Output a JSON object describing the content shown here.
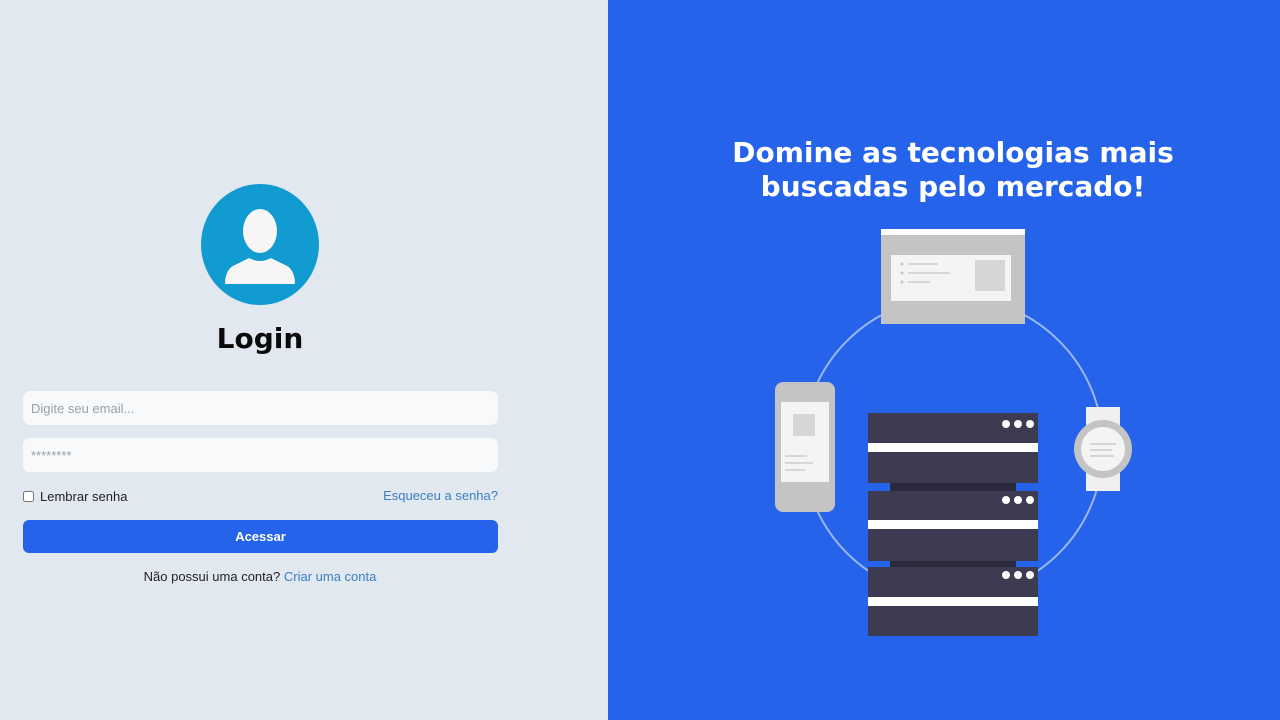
{
  "login": {
    "title": "Login",
    "email_placeholder": "Digite seu email...",
    "password_placeholder": "********",
    "remember_label": "Lembrar senha",
    "forgot_link": "Esqueceu a senha?",
    "submit_label": "Acessar",
    "no_account_text": "Não possui uma conta?",
    "signup_link": "Criar uma conta"
  },
  "promo": {
    "headline_part1": "Domine as ",
    "headline_bold1": "tecnologias mais",
    "headline_bold2": "buscadas",
    "headline_part2": " pelo mercado!"
  },
  "colors": {
    "left_background": "#e2e8f0",
    "right_background": "#2563eb",
    "primary_button": "#2563eb",
    "avatar": "#119bd0",
    "link": "#3b7fc0"
  },
  "icons": {
    "avatar": "user-silhouette-icon",
    "illustration": "devices-network-illustration"
  }
}
